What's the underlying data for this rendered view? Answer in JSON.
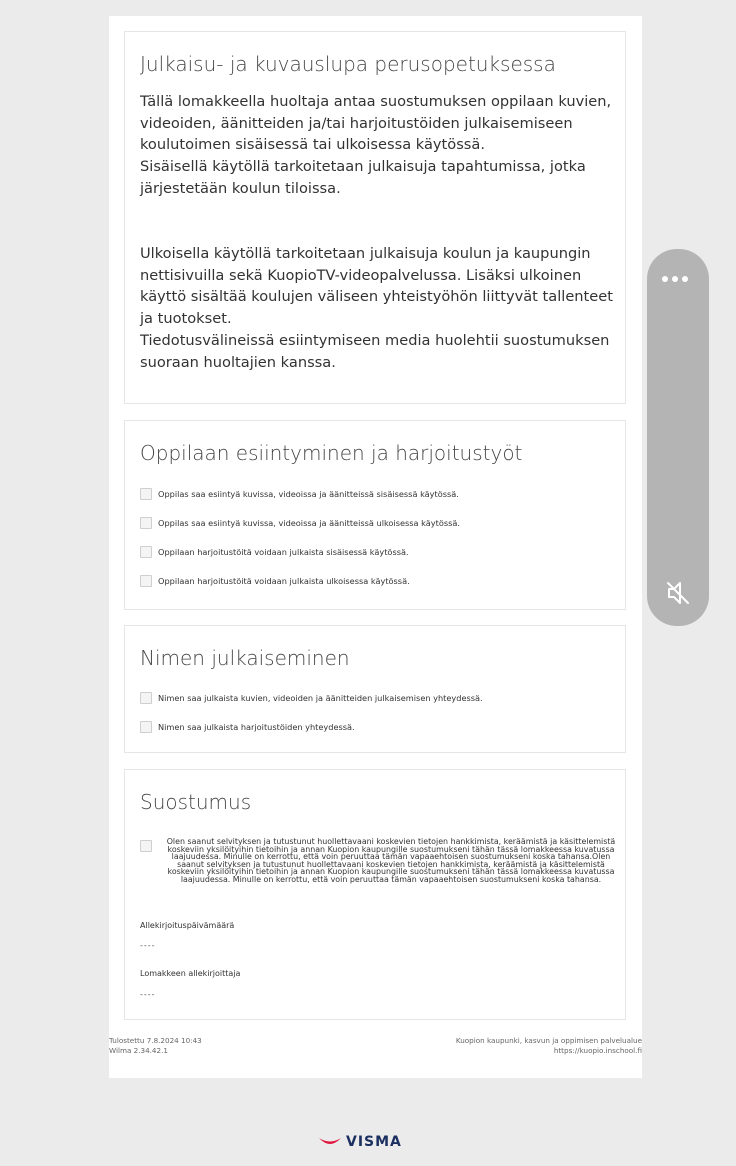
{
  "section1": {
    "title": "Julkaisu- ja kuvauslupa perusopetuksessa",
    "p1": "Tällä lomakkeella huoltaja antaa suostumuksen oppilaan kuvien, videoiden, äänitteiden ja/tai harjoitustöiden julkaisemiseen koulutoimen sisäisessä tai ulkoisessa käytössä.",
    "p2": "Sisäisellä käytöllä tarkoitetaan julkaisuja tapahtumissa, jotka järjestetään koulun tiloissa.",
    "p3": "Ulkoisella käytöllä tarkoitetaan julkaisuja koulun ja kaupungin nettisivuilla sekä KuopioTV-videopalvelussa. Lisäksi ulkoinen käyttö sisältää koulujen väliseen yhteistyöhön liittyvät tallenteet ja tuotokset.",
    "p4": "Tiedotusvälineissä esiintymiseen media huolehtii suostumuksen suoraan huoltajien kanssa."
  },
  "section2": {
    "title": "Oppilaan esiintyminen ja harjoitustyöt",
    "options": [
      "Oppilas saa esiintyä kuvissa, videoissa ja äänitteissä sisäisessä käytössä.",
      "Oppilas saa esiintyä kuvissa, videoissa ja äänitteissä ulkoisessa käytössä.",
      "Oppilaan harjoitustöitä voidaan julkaista sisäisessä käytössä.",
      "Oppilaan harjoitustöitä voidaan julkaista ulkoisessa käytössä."
    ]
  },
  "section3": {
    "title": "Nimen julkaiseminen",
    "options": [
      "Nimen saa julkaista kuvien, videoiden ja äänitteiden julkaisemisen yhteydessä.",
      "Nimen saa julkaista harjoitustöiden yhteydessä."
    ]
  },
  "section4": {
    "title": "Suostumus",
    "consent_text": "Olen saanut selvityksen ja tutustunut huollettavaani koskevien tietojen hankkimista, keräämistä ja käsittelemistä koskeviin yksilöityihin tietoihin ja annan Kuopion kaupungille suostumukseni tähän tässä lomakkeessa kuvatussa laajuudessa. Minulle on kerrottu, että voin peruuttaa tämän vapaaehtoisen suostumukseni koska tahansa.Olen saanut selvityksen ja tutustunut huollettavaani koskevien tietojen hankkimista, keräämistä ja käsittelemistä koskeviin yksilöityihin tietoihin ja annan Kuopion kaupungille suostumukseni tähän tässä lomakkeessa kuvatussa laajuudessa. Minulle on kerrottu, että voin peruuttaa tämän vapaaehtoisen suostumukseni koska tahansa.",
    "date_label": "Allekirjoituspäivämäärä",
    "date_value": "----",
    "signer_label": "Lomakkeen allekirjoittaja",
    "signer_value": "----"
  },
  "footer": {
    "printed": "Tulostettu 7.8.2024 10:43",
    "version": "Wilma 2.34.42.1",
    "organization": "Kuopion kaupunki, kasvun ja oppimisen palvelualue",
    "url": "https://kuopio.inschool.fi"
  },
  "brand": {
    "name": "VISMA",
    "color": "#1b3060",
    "accent": "#e0173f"
  },
  "side_panel": {
    "menu_icon": "more-dots-icon",
    "mute_icon": "speaker-muted-icon"
  }
}
